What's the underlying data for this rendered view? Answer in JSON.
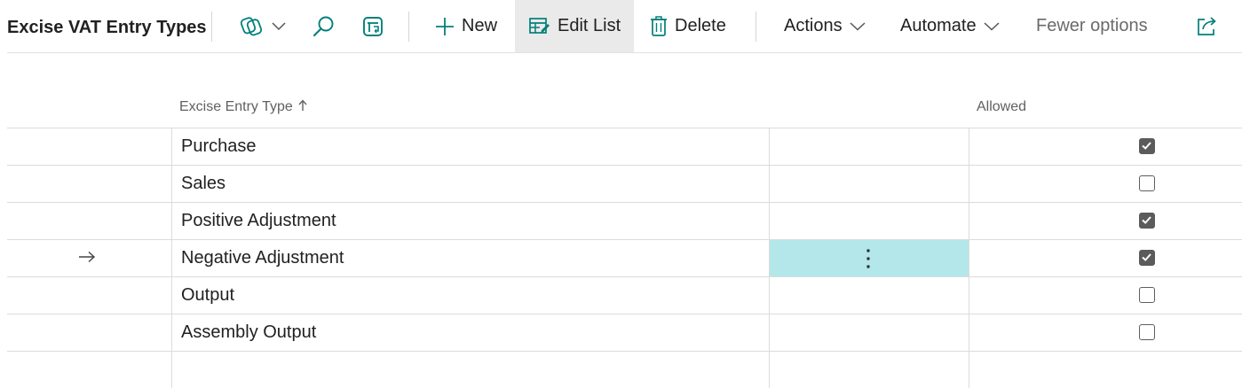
{
  "header": {
    "title": "Excise VAT Entry Types"
  },
  "toolbar": {
    "share_mode_icon": "copilot-icon",
    "search_icon": "search-icon",
    "filter_pane_icon": "filter-pane-icon",
    "new_label": "New",
    "edit_list_label": "Edit List",
    "delete_label": "Delete",
    "actions_label": "Actions",
    "automate_label": "Automate",
    "fewer_options_label": "Fewer options",
    "share_icon": "share-icon"
  },
  "table": {
    "columns": [
      {
        "label": "Excise Entry Type",
        "sort": "ascending"
      },
      {
        "label": "Allowed"
      }
    ],
    "rows": [
      {
        "type": "Purchase",
        "allowed": true,
        "current": false
      },
      {
        "type": "Sales",
        "allowed": false,
        "current": false
      },
      {
        "type": "Positive Adjustment",
        "allowed": true,
        "current": false
      },
      {
        "type": "Negative Adjustment",
        "allowed": true,
        "current": true
      },
      {
        "type": "Output",
        "allowed": false,
        "current": false
      },
      {
        "type": "Assembly Output",
        "allowed": false,
        "current": false
      },
      {
        "type": "",
        "allowed": null,
        "current": false
      }
    ]
  },
  "colors": {
    "accent": "#00807a",
    "focus_cell": "#b3e7ea",
    "checkbox_checked": "#5b5b5b"
  }
}
